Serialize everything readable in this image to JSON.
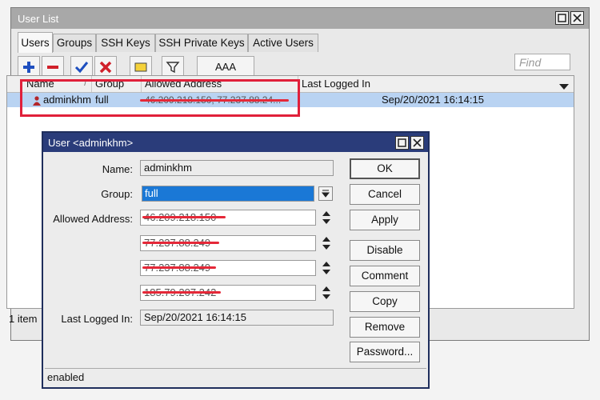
{
  "window": {
    "title": "User List",
    "tabs": [
      "Users",
      "Groups",
      "SSH Keys",
      "SSH Private Keys",
      "Active Users"
    ],
    "active_tab": "Users",
    "toolbar": {
      "aaa_label": "AAA"
    },
    "find_placeholder": "Find",
    "columns": [
      "Name",
      "Group",
      "Allowed Address",
      "Last Logged In"
    ],
    "rows": [
      {
        "name": "adminkhm",
        "group": "full",
        "allowed_address": "46.209.218.150, 77.237.88.24...",
        "last_logged_in": "Sep/20/2021 16:14:15"
      }
    ],
    "status": "1 item"
  },
  "dialog": {
    "title": "User <adminkhm>",
    "name_label": "Name:",
    "name_value": "adminkhm",
    "group_label": "Group:",
    "group_value": "full",
    "allowed_label": "Allowed Address:",
    "allowed_addresses": [
      "46.209.218.150",
      "77.237.88.249",
      "77.237.88.249",
      "185.79.207.242"
    ],
    "last_logged_label": "Last Logged In:",
    "last_logged_value": "Sep/20/2021 16:14:15",
    "buttons": [
      "OK",
      "Cancel",
      "Apply",
      "Disable",
      "Comment",
      "Copy",
      "Remove",
      "Password..."
    ],
    "status": "enabled"
  },
  "colors": {
    "accent_selection": "#1a78d6",
    "dialog_title": "#2a3c7a",
    "highlight": "#e0203a",
    "row_selected": "#b9d3f2"
  }
}
